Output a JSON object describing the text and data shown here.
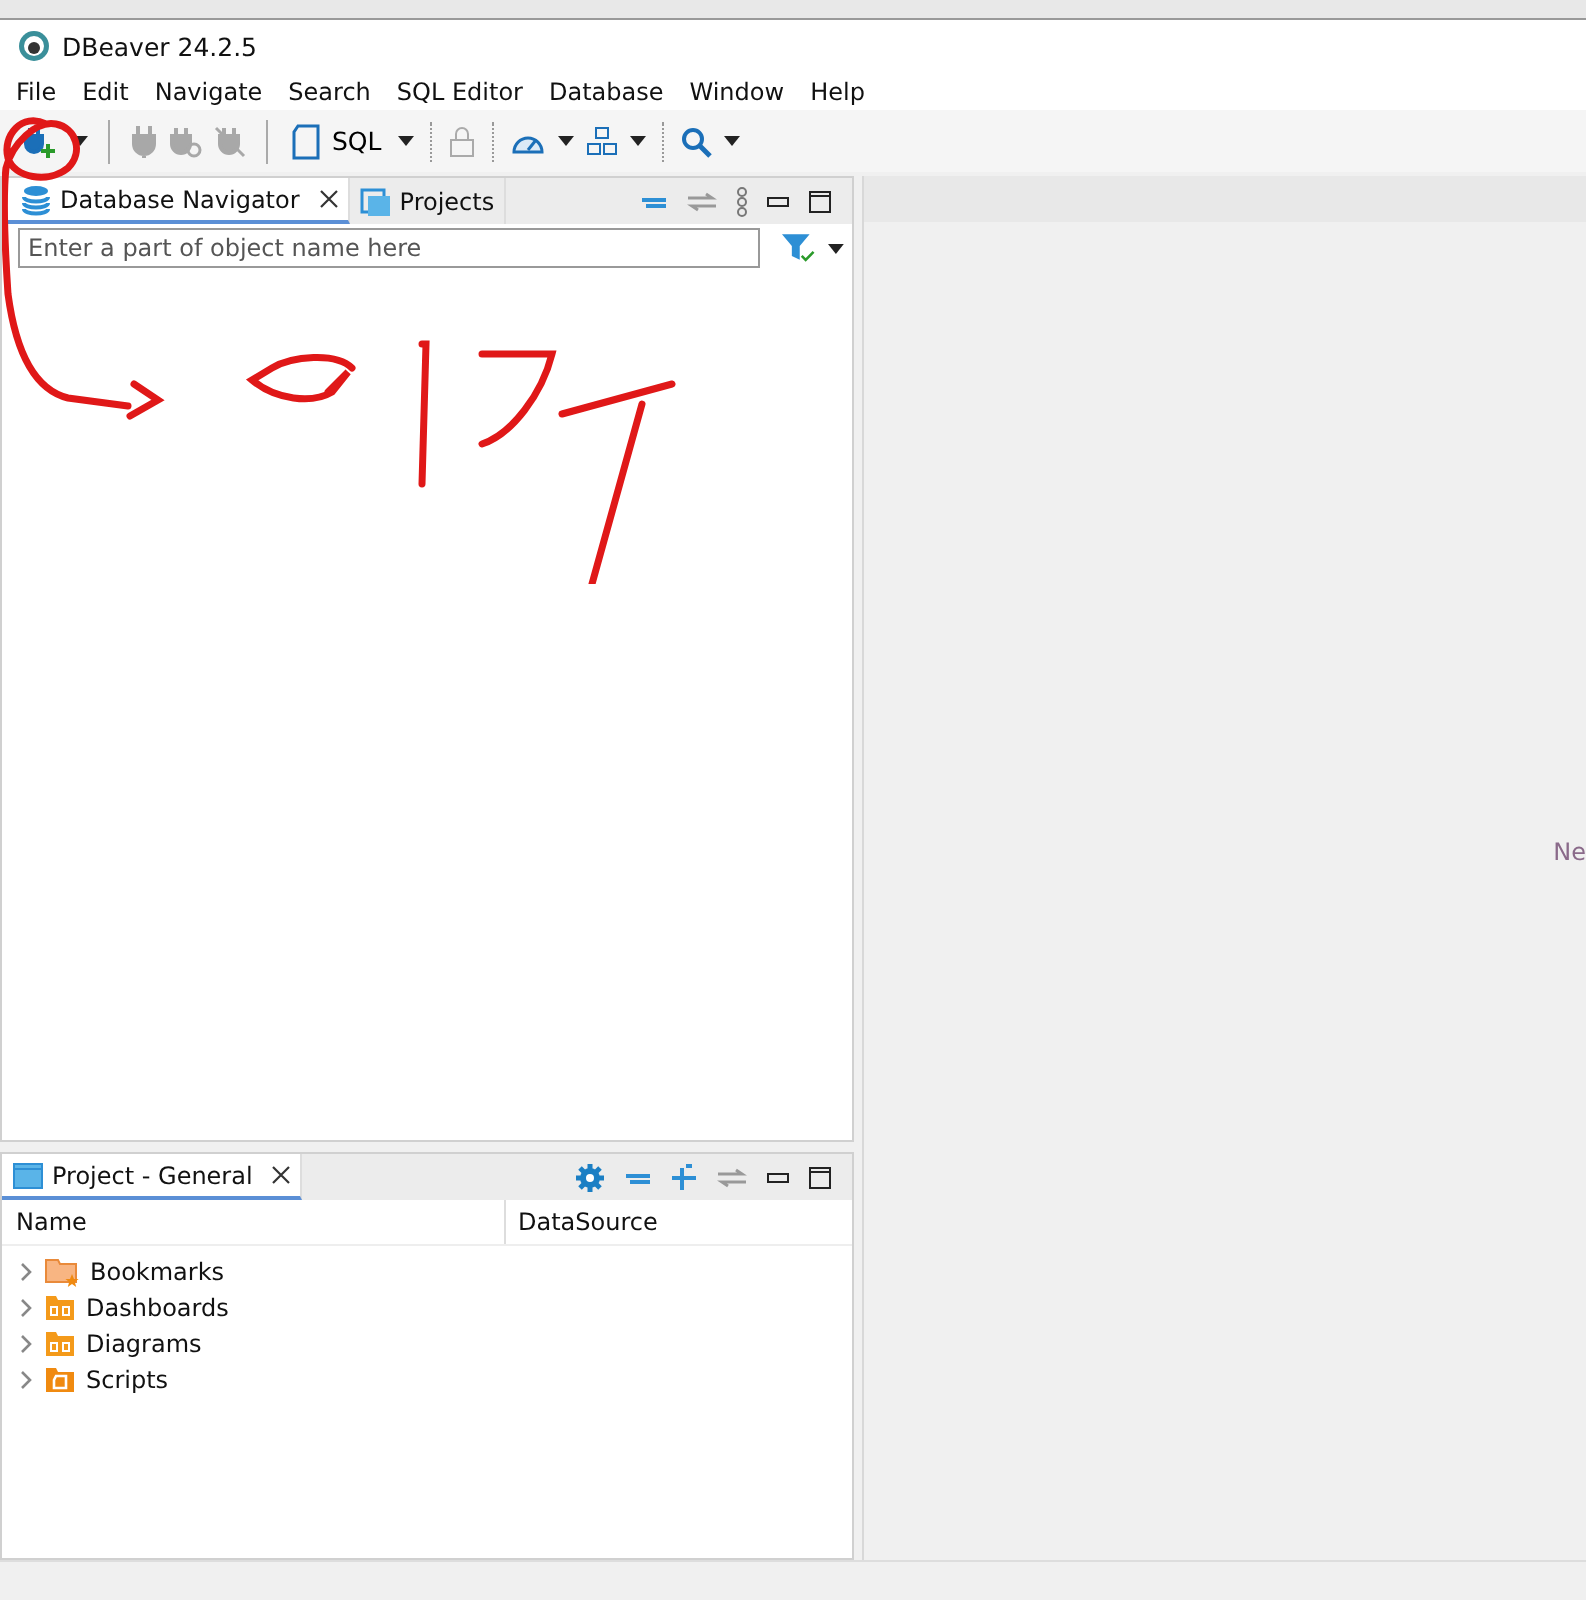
{
  "window": {
    "title": "DBeaver 24.2.5"
  },
  "menu": [
    "File",
    "Edit",
    "Navigate",
    "Search",
    "SQL Editor",
    "Database",
    "Window",
    "Help"
  ],
  "toolbar": {
    "sql_label": "SQL"
  },
  "navigator": {
    "tabs": [
      {
        "label": "Database Navigator",
        "selected": true,
        "closable": true
      },
      {
        "label": "Projects",
        "selected": false,
        "closable": false
      }
    ],
    "filter": {
      "placeholder": "Enter a part of object name here"
    }
  },
  "project_panel": {
    "tab": "Project - General",
    "columns": [
      "Name",
      "DataSource"
    ],
    "items": [
      {
        "label": "Bookmarks",
        "kind": "bookmarks",
        "expanded": false
      },
      {
        "label": "Dashboards",
        "kind": "dashboards",
        "expanded": false
      },
      {
        "label": "Diagrams",
        "kind": "diagrams",
        "expanded": false
      },
      {
        "label": "Scripts",
        "kind": "scripts",
        "expanded": false
      }
    ]
  },
  "editor_area": {
    "hint": "Ne"
  }
}
